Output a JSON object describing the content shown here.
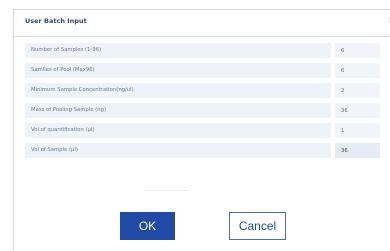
{
  "dialog": {
    "title": "User Batch Input",
    "close_label": "×"
  },
  "form": {
    "rows": [
      {
        "label": "Number of Samples  (1-96)",
        "value": "6"
      },
      {
        "label": "Samlles of  Pool  (Max96)",
        "value": "6"
      },
      {
        "label": "Minimum Sample Concentration(ng/ul)",
        "value": "2"
      },
      {
        "label": "Mass of Pooling Sample (ng)",
        "value": "36"
      },
      {
        "label": "Vol of quantification  (μl)",
        "value": "1"
      },
      {
        "label": "Vol of Sample  (μl)",
        "value": "36"
      }
    ]
  },
  "buttons": {
    "ok_label": "OK",
    "cancel_label": "Cancel"
  }
}
